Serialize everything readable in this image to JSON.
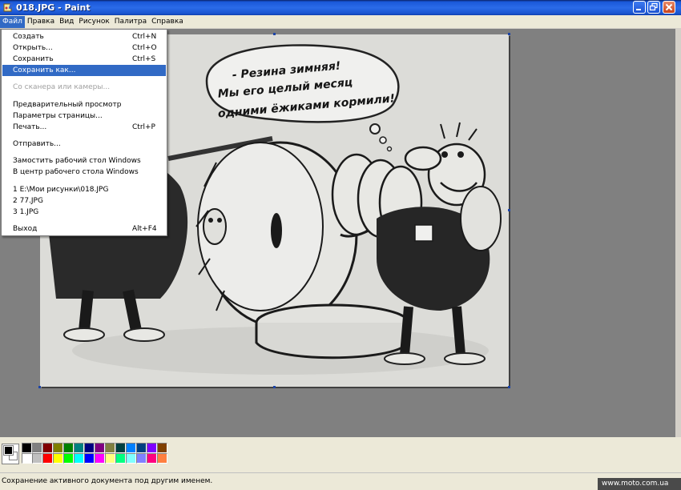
{
  "window": {
    "title": "018.JPG - Paint"
  },
  "menubar": [
    {
      "label": "Файл"
    },
    {
      "label": "Правка"
    },
    {
      "label": "Вид"
    },
    {
      "label": "Рисунок"
    },
    {
      "label": "Палитра"
    },
    {
      "label": "Справка"
    }
  ],
  "file_menu": {
    "items": [
      {
        "label": "Создать",
        "shortcut": "Ctrl+N"
      },
      {
        "label": "Открыть...",
        "shortcut": "Ctrl+O"
      },
      {
        "label": "Сохранить",
        "shortcut": "Ctrl+S"
      },
      {
        "label": "Сохранить как...",
        "shortcut": ""
      },
      {
        "label": "Со сканера или камеры...",
        "shortcut": ""
      },
      {
        "label": "Предварительный просмотр",
        "shortcut": ""
      },
      {
        "label": "Параметры страницы...",
        "shortcut": ""
      },
      {
        "label": "Печать...",
        "shortcut": "Ctrl+P"
      },
      {
        "label": "Отправить...",
        "shortcut": ""
      },
      {
        "label": "Замостить рабочий стол Windows",
        "shortcut": ""
      },
      {
        "label": "В центр рабочего стола Windows",
        "shortcut": ""
      },
      {
        "label": "1 E:\\Мои рисунки\\018.JPG",
        "shortcut": ""
      },
      {
        "label": "2 77.JPG",
        "shortcut": ""
      },
      {
        "label": "3 1.JPG",
        "shortcut": ""
      },
      {
        "label": "Выход",
        "shortcut": "Alt+F4"
      }
    ],
    "selected": "Сохранить как...",
    "disabled": [
      "Со сканера или камеры..."
    ]
  },
  "canvas": {
    "speech_bubble": [
      "- Резина зимняя!",
      "Мы его целый месяц",
      "одними ёжиками кормили!"
    ]
  },
  "palette": {
    "foreground": "#000000",
    "background": "#ffffff",
    "colors": [
      "#000000",
      "#808080",
      "#800000",
      "#808000",
      "#008000",
      "#008080",
      "#000080",
      "#800080",
      "#808040",
      "#004040",
      "#0080ff",
      "#004080",
      "#8000ff",
      "#804000",
      "#ffffff",
      "#c0c0c0",
      "#ff0000",
      "#ffff00",
      "#00ff00",
      "#00ffff",
      "#0000ff",
      "#ff00ff",
      "#ffff80",
      "#00ff80",
      "#80ffff",
      "#8080ff",
      "#ff0080",
      "#ff8040"
    ]
  },
  "status": {
    "text": "Сохранение активного документа под другим именем."
  },
  "watermark": {
    "text": "www.moto.com.ua"
  }
}
